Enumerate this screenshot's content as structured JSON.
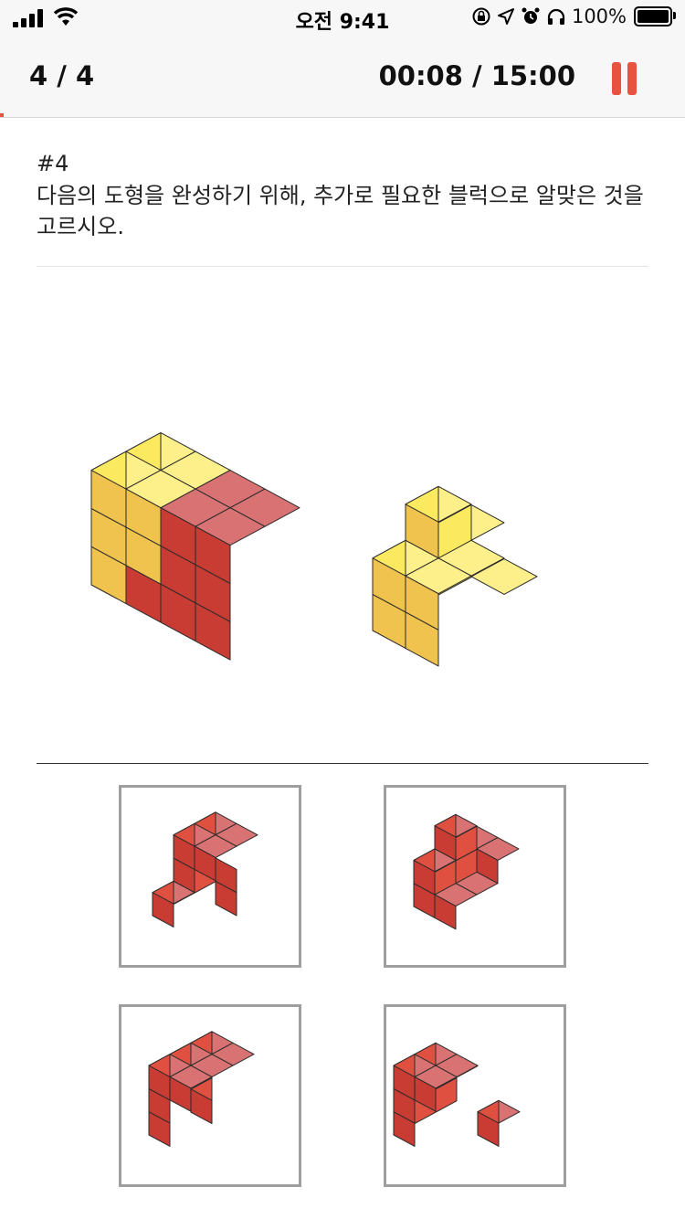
{
  "status_bar": {
    "time": "오전 9:41",
    "battery": "100%",
    "icons": [
      "signal-icon",
      "wifi-icon",
      "orientation-lock-icon",
      "location-icon",
      "alarm-icon",
      "headphones-icon",
      "battery-icon"
    ]
  },
  "header": {
    "counter": "4 / 4",
    "timer": "00:08 / 15:00",
    "pause_icon": "pause-icon"
  },
  "question": {
    "number": "#4",
    "text": "다음의 도형을 완성하기 위해, 추가로 필요한 블럭으로 알맞은 것을 고르시오."
  },
  "colors": {
    "accent": "#e8533f",
    "yellow_front": "#fbe960",
    "yellow_top": "#fdf08a",
    "yellow_side": "#f0c24e",
    "red_front": "#e05040",
    "red_top": "#d97373",
    "red_side": "#c83c34"
  },
  "choices": [
    {
      "id": 1,
      "icon": "red-block-option-1"
    },
    {
      "id": 2,
      "icon": "red-block-option-2"
    },
    {
      "id": 3,
      "icon": "red-block-option-3"
    },
    {
      "id": 4,
      "icon": "red-block-option-4"
    }
  ]
}
